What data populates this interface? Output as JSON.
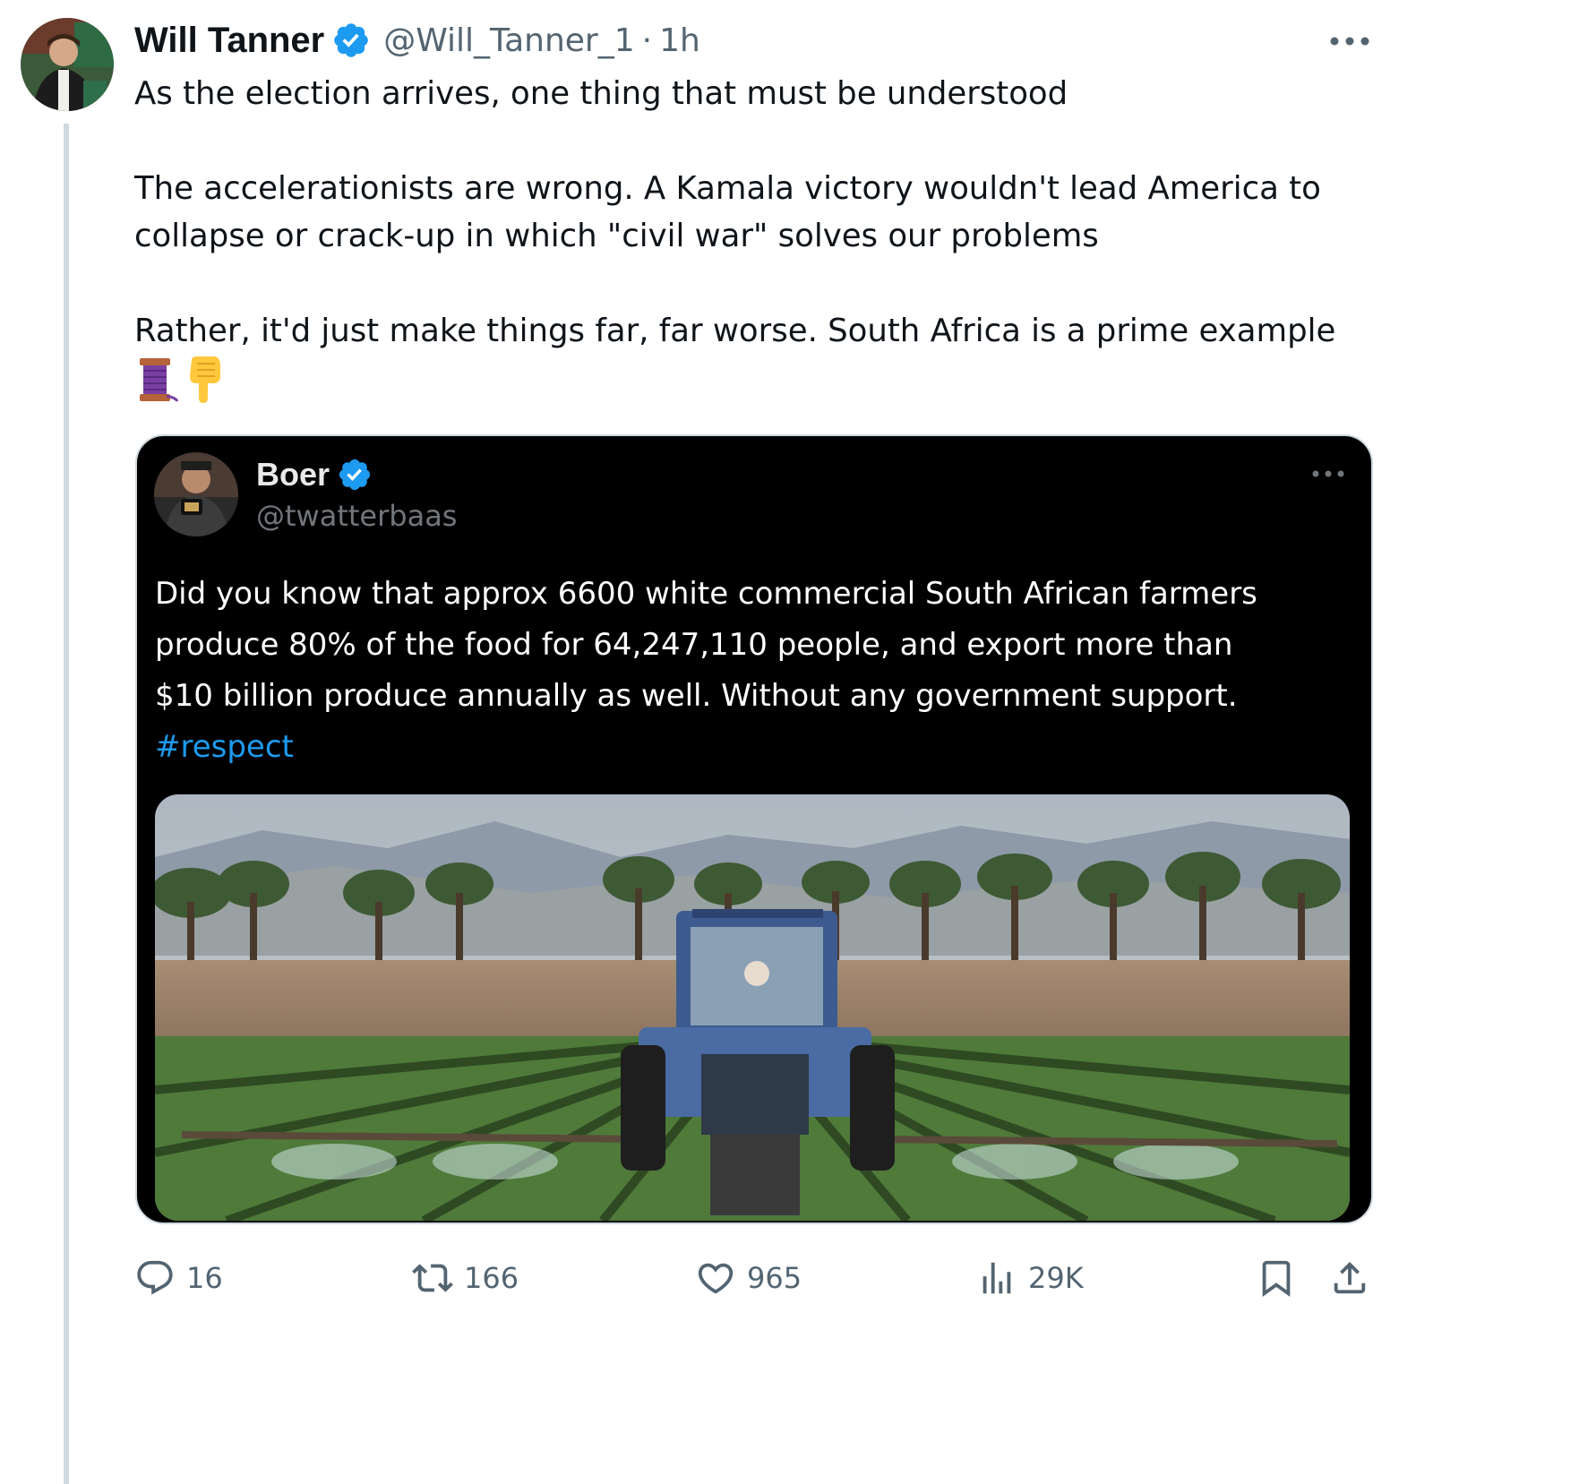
{
  "tweet": {
    "author": {
      "display_name": "Will Tanner",
      "handle": "@Will_Tanner_1",
      "verified": true
    },
    "separator": "·",
    "time": "1h",
    "text_lines": [
      "As the election arrives, one thing that must be understood",
      "The accelerationists are wrong. A Kamala victory wouldn't lead America to",
      "collapse or crack-up in which \"civil war\" solves our problems",
      "Rather, it'd just make things far, far worse. South Africa is a prime example"
    ],
    "emojis": [
      "thread-spool-icon",
      "pointing-down-icon"
    ]
  },
  "quoted_tweet": {
    "author": {
      "display_name": "Boer",
      "handle": "@twatterbaas",
      "verified": true
    },
    "text_lines": [
      "Did you know that approx 6600 white commercial South African farmers",
      "produce 80% of the food for 64,247,110 people, and export more than",
      "$10 billion produce annually as well. Without any government support."
    ],
    "hashtag": "#respect"
  },
  "actions": {
    "replies": "16",
    "reposts": "166",
    "likes": "965",
    "views": "29K"
  },
  "colors": {
    "text": "#0f1419",
    "secondary": "#536471",
    "accent": "#1d9bf0",
    "quote_bg": "#000000",
    "quote_secondary": "#71767b",
    "thread_line": "#cfd9de"
  }
}
